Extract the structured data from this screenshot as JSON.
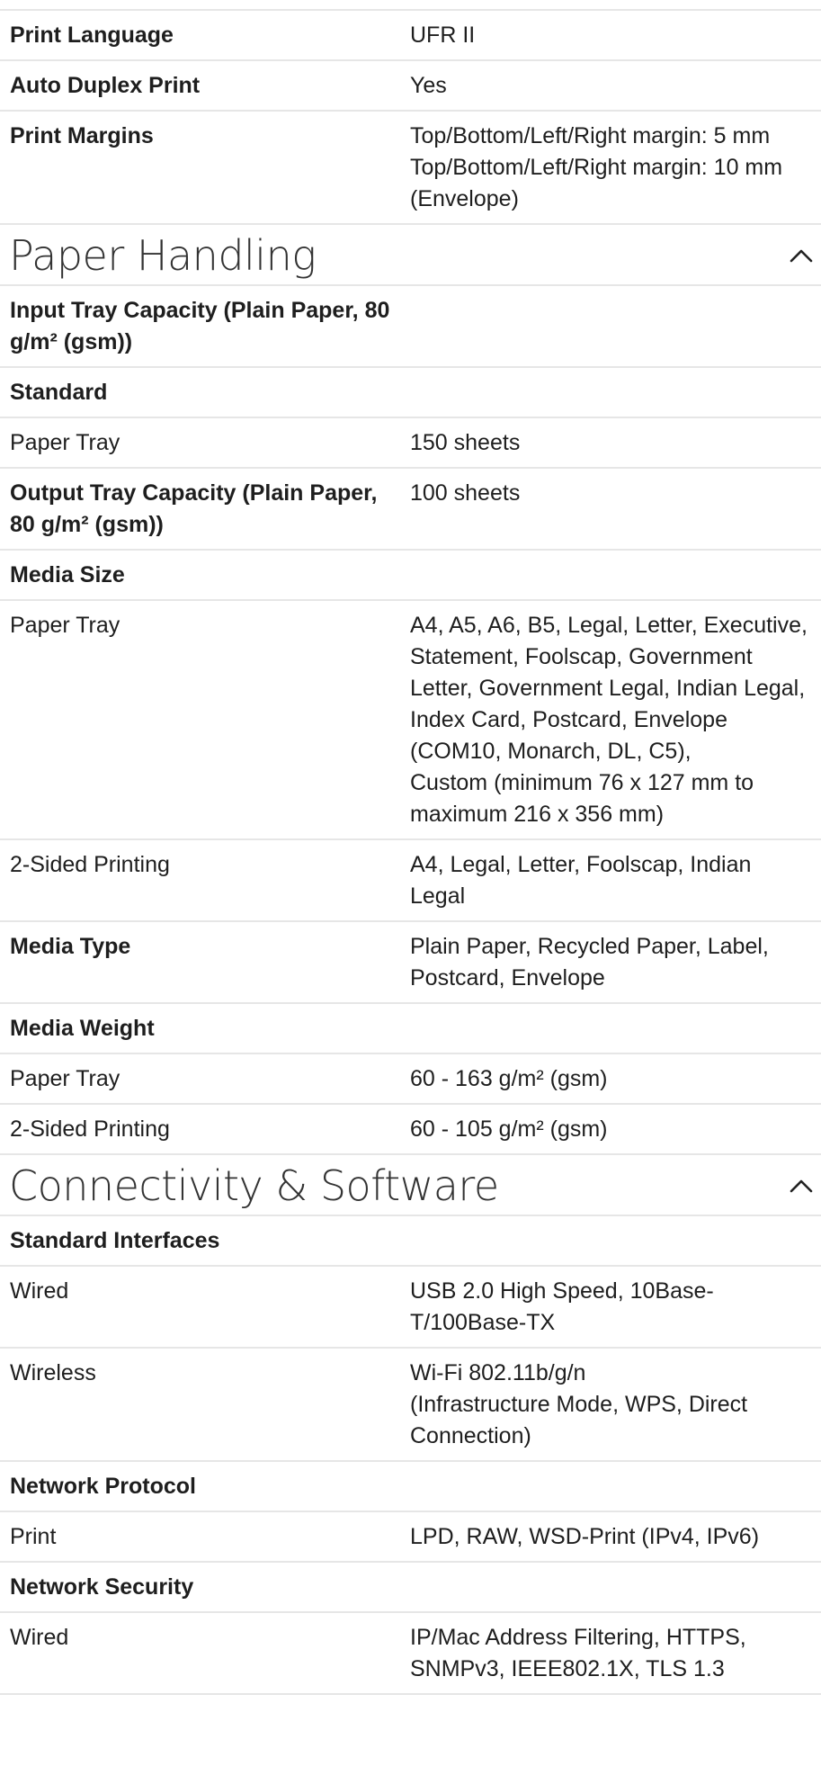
{
  "top_rows": [
    {
      "label": "Print Language",
      "value": "UFR II",
      "kind": "bold"
    },
    {
      "label": "Auto Duplex Print",
      "value": "Yes",
      "kind": "bold"
    },
    {
      "label": "Print Margins",
      "value": "Top/Bottom/Left/Right margin: 5 mm\nTop/Bottom/Left/Right margin: 10 mm (Envelope)",
      "kind": "bold"
    }
  ],
  "sections": [
    {
      "title": "Paper Handling",
      "toggle_icon": "chevron-up-icon",
      "rows": [
        {
          "label": "Input Tray Capacity (Plain Paper, 80 g/m² (gsm))",
          "value": "",
          "kind": "bold"
        },
        {
          "label": "Standard",
          "value": "",
          "kind": "bold"
        },
        {
          "label": "Paper Tray",
          "value": "150 sheets",
          "kind": "sub"
        },
        {
          "label": "Output Tray Capacity (Plain Paper, 80 g/m² (gsm))",
          "value": "100 sheets",
          "kind": "bold"
        },
        {
          "label": "Media Size",
          "value": "",
          "kind": "bold"
        },
        {
          "label": "Paper Tray",
          "value": "A4, A5, A6, B5, Legal, Letter, Executive, Statement, Foolscap, Government Letter, Government Legal, Indian Legal, Index Card, Postcard, Envelope (COM10, Monarch, DL, C5),\nCustom (minimum 76 x 127 mm to maximum 216 x 356 mm)",
          "kind": "sub"
        },
        {
          "label": "2-Sided Printing",
          "value": "A4, Legal, Letter, Foolscap, Indian Legal",
          "kind": "sub"
        },
        {
          "label": "Media Type",
          "value": "Plain Paper, Recycled Paper, Label, Postcard, Envelope",
          "kind": "bold"
        },
        {
          "label": "Media Weight",
          "value": "",
          "kind": "bold"
        },
        {
          "label": "Paper Tray",
          "value": "60 - 163 g/m² (gsm)",
          "kind": "sub"
        },
        {
          "label": "2-Sided Printing",
          "value": "60 - 105 g/m² (gsm)",
          "kind": "sub"
        }
      ]
    },
    {
      "title": "Connectivity & Software",
      "toggle_icon": "chevron-up-icon",
      "rows": [
        {
          "label": "Standard Interfaces",
          "value": "",
          "kind": "bold"
        },
        {
          "label": "Wired",
          "value": "USB 2.0 High Speed, 10Base-T/100Base-TX",
          "kind": "sub"
        },
        {
          "label": "Wireless",
          "value": "Wi-Fi 802.11b/g/n\n(Infrastructure Mode, WPS, Direct Connection)",
          "kind": "sub"
        },
        {
          "label": "Network Protocol",
          "value": "",
          "kind": "bold"
        },
        {
          "label": "Print",
          "value": "LPD, RAW, WSD-Print (IPv4, IPv6)",
          "kind": "sub"
        },
        {
          "label": "Network Security",
          "value": "",
          "kind": "bold"
        },
        {
          "label": "Wired",
          "value": "IP/Mac Address Filtering, HTTPS, SNMPv3, IEEE802.1X, TLS 1.3",
          "kind": "sub"
        }
      ]
    }
  ]
}
